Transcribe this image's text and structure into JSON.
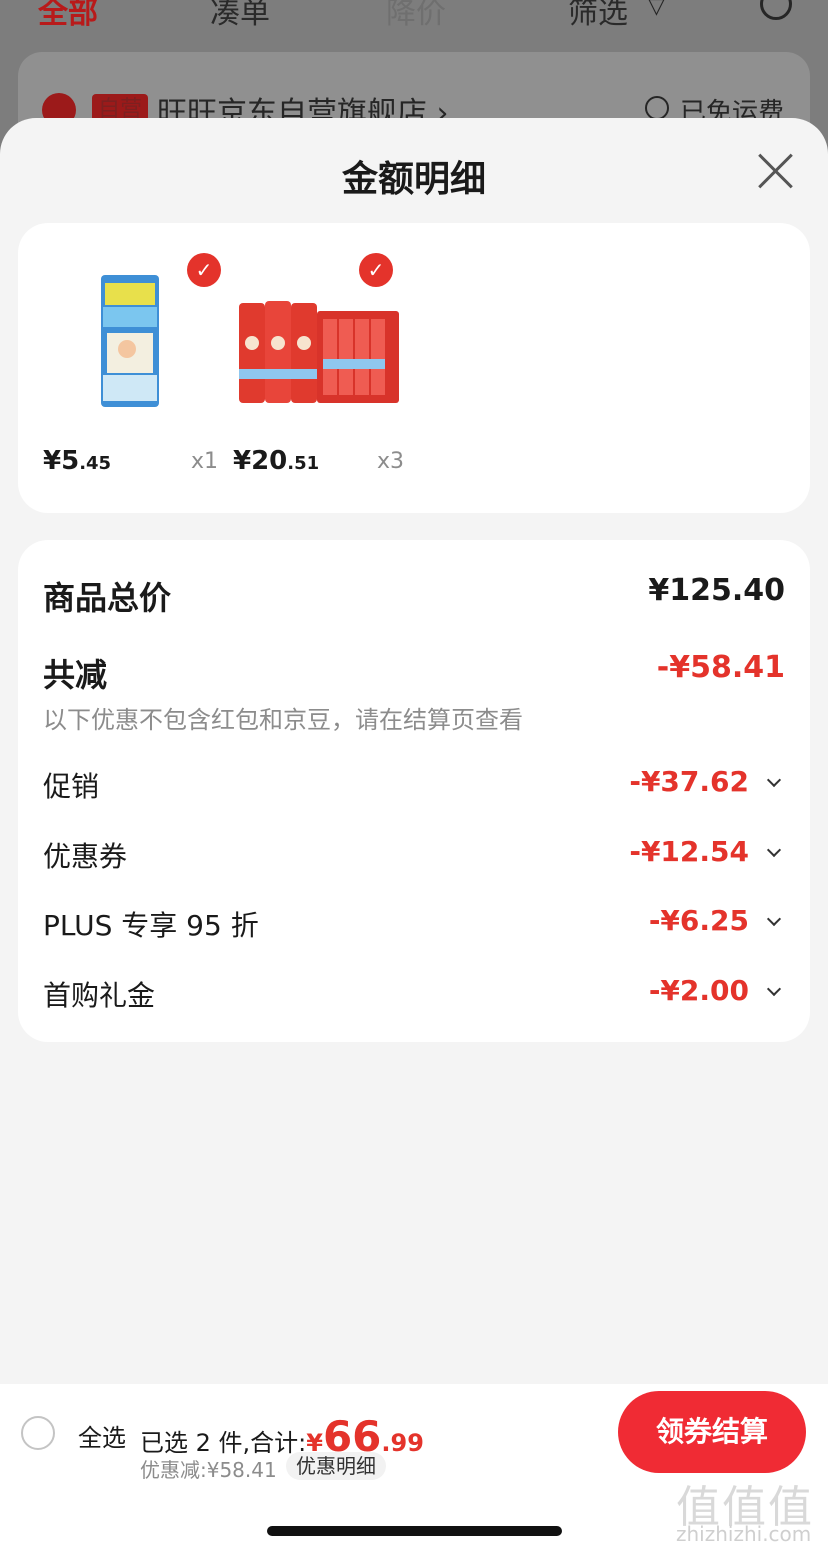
{
  "background": {
    "tabs": [
      "全部",
      "凑单",
      "降价",
      "筛选"
    ],
    "store": {
      "badge": "自营",
      "name": "旺旺京东自营旗舰店 ›",
      "shipping": "已免运费"
    }
  },
  "modal": {
    "title": "金额明细",
    "products": [
      {
        "price_int": "¥5",
        "price_dec": ".45",
        "qty": "x1",
        "icon": "popsicle-product-image"
      },
      {
        "price_int": "¥20",
        "price_dec": ".51",
        "qty": "x3",
        "icon": "milk-product-image"
      }
    ],
    "summary": {
      "total_label": "商品总价",
      "total_value": "¥125.40",
      "reduce_label": "共减",
      "reduce_value": "-¥58.41",
      "note": "以下优惠不包含红包和京豆，请在结算页查看",
      "items": [
        {
          "label": "促销",
          "value": "-¥37.62"
        },
        {
          "label": "优惠券",
          "value": "-¥12.54"
        },
        {
          "label": "PLUS 专享 95 折",
          "value": "-¥6.25"
        },
        {
          "label": "首购礼金",
          "value": "-¥2.00"
        }
      ]
    }
  },
  "bottom_bar": {
    "select_all": "全选",
    "selected_text": "已选 2 件,合计:",
    "total_yen": "¥",
    "total_int": "66",
    "total_dec": ".99",
    "discount_text": "优惠减:¥58.41",
    "detail_label": "优惠明细",
    "checkout_label": "领券结算"
  },
  "watermark": {
    "logo": "值值值",
    "url": "zhizhizhi.com"
  },
  "colors": {
    "accent": "#e4332b",
    "button": "#f02b34"
  }
}
